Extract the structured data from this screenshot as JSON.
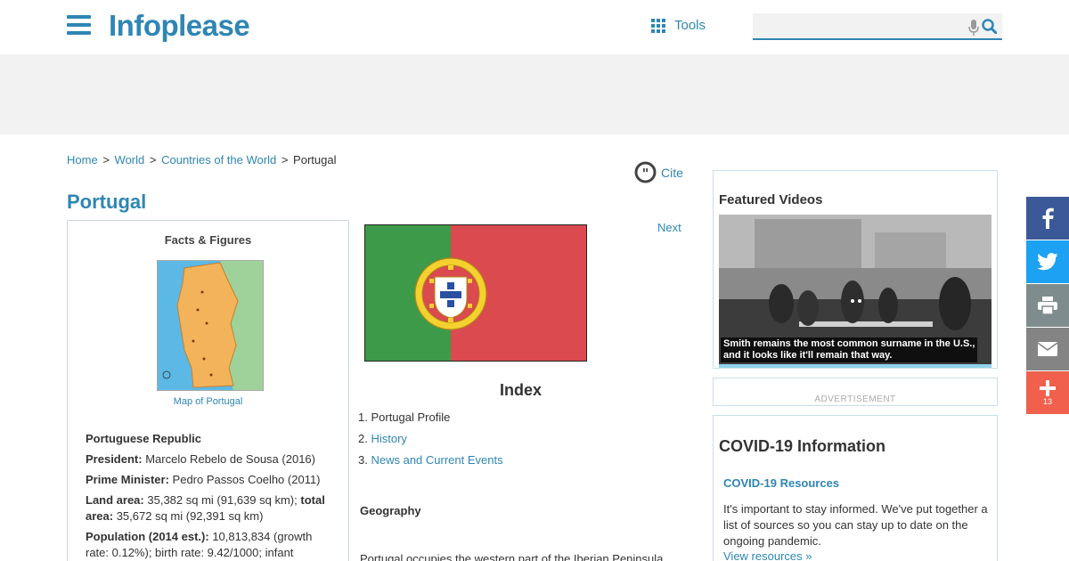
{
  "header": {
    "logo": "Infoplease",
    "tools_label": "Tools",
    "search_placeholder": ""
  },
  "breadcrumb": {
    "items": [
      "Home",
      "World",
      "Countries of the World"
    ],
    "current": "Portugal",
    "separator": ">"
  },
  "cite_label": "Cite",
  "page_title": "Portugal",
  "facts": {
    "title": "Facts & Figures",
    "map_caption": "Map of Portugal",
    "official_name": "Portuguese Republic",
    "president_label": "President:",
    "president_value": "Marcelo Rebelo de Sousa (2016)",
    "pm_label": "Prime Minister:",
    "pm_value": "Pedro Passos Coelho (2011)",
    "land_label": "Land area:",
    "land_value": "35,382 sq mi (91,639 sq km);",
    "total_label": "total area:",
    "total_value": "35,672 sq mi (92,391 sq km)",
    "pop_label": "Population (2014 est.):",
    "pop_value": "10,813,834 (growth rate: 0.12%); birth rate: 9.42/1000; infant"
  },
  "next_label": "Next",
  "index": {
    "title": "Index",
    "items": [
      {
        "num": "1.",
        "label": "Portugal Profile"
      },
      {
        "num": "2.",
        "label": "History"
      },
      {
        "num": "3.",
        "label": "News and Current Events"
      }
    ]
  },
  "geography": {
    "title": "Geography",
    "text": "Portugal occupies the western part of the Iberian Peninsula"
  },
  "videos": {
    "title": "Featured Videos",
    "caption_line1": "Smith remains the most common surname in the U.S.,",
    "caption_line2": "and it looks like it'll remain that way."
  },
  "advertisement_label": "ADVERTISEMENT",
  "covid": {
    "title": "COVID-19 Information",
    "subtitle": "COVID-19 Resources",
    "text": "It's important to stay informed. We've put together a list of sources so you can stay up to date on the ongoing pandemic.",
    "link": "View resources »"
  },
  "share": {
    "count": "13"
  },
  "colors": {
    "brand": "#2e86b5",
    "facebook": "#3b5998",
    "twitter": "#1da1f2",
    "print": "#7f8c8d",
    "email": "#848484",
    "more": "#f0604d",
    "flag_green": "#3d9a48",
    "flag_red": "#da4a4f"
  }
}
